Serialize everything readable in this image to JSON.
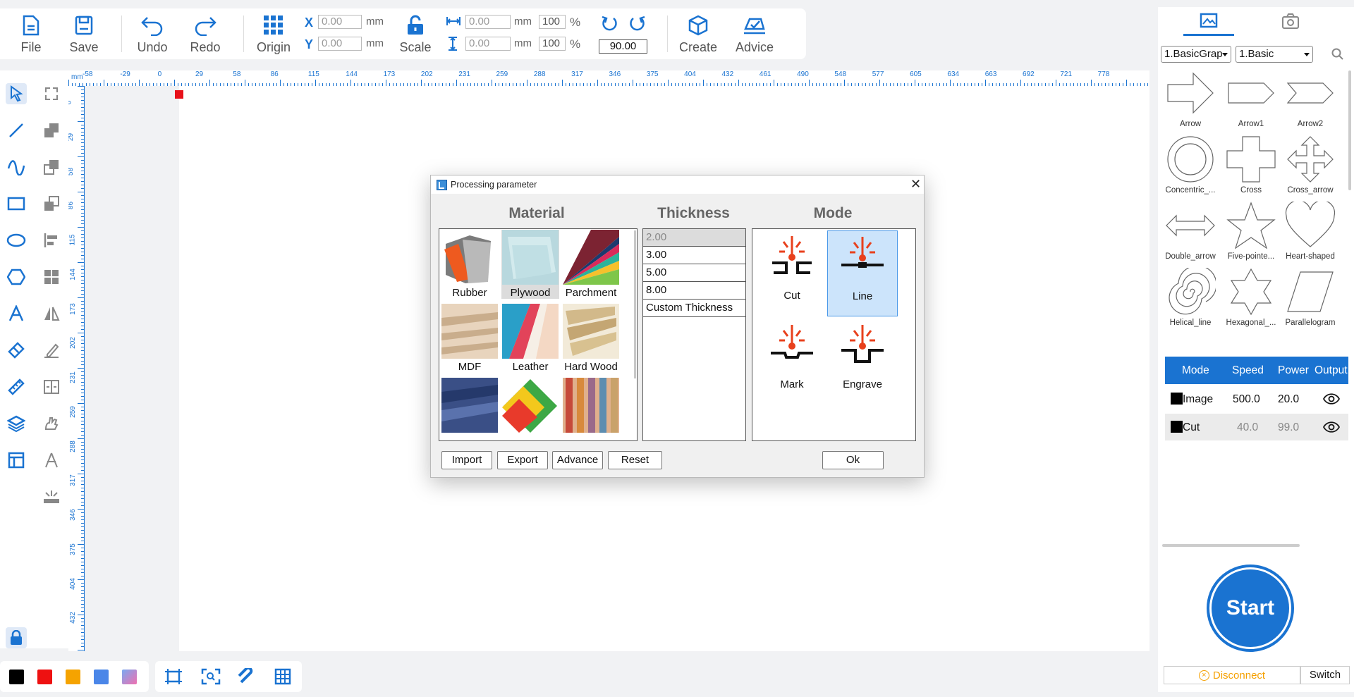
{
  "toolbar": {
    "file": "File",
    "save": "Save",
    "undo": "Undo",
    "redo": "Redo",
    "origin": "Origin",
    "scale": "Scale",
    "create": "Create",
    "advice": "Advice",
    "x_label": "X",
    "y_label": "Y",
    "x_value": "0.00",
    "y_value": "0.00",
    "unit": "mm",
    "w_value": "0.00",
    "h_value": "0.00",
    "w_pct": "100",
    "h_pct": "100",
    "pct_sign": "%",
    "rotation": "90.00"
  },
  "ruler": {
    "unit": "mm",
    "top_ticks": [
      "-58",
      "-29",
      "0",
      "29",
      "58",
      "86",
      "115",
      "144",
      "173",
      "202",
      "231",
      "259",
      "288",
      "317",
      "346",
      "375",
      "404",
      "432",
      "461",
      "490",
      "548",
      "577",
      "605",
      "634",
      "663",
      "692",
      "721",
      "778"
    ],
    "left_ticks": [
      "0",
      "29",
      "58",
      "86",
      "115",
      "144",
      "173",
      "202",
      "231",
      "259",
      "288",
      "317",
      "346",
      "375",
      "404",
      "432"
    ]
  },
  "colors": {
    "accent": "#1a73d1",
    "swatches": [
      "#000000",
      "#ee1111",
      "#f5a300",
      "#4a86e8",
      "#e870b0"
    ]
  },
  "dialog": {
    "title": "Processing parameter",
    "material_header": "Material",
    "thickness_header": "Thickness",
    "mode_header": "Mode",
    "materials": [
      "Rubber",
      "Plywood",
      "Parchment",
      "MDF",
      "Leather",
      "Hard Wood",
      "",
      "",
      ""
    ],
    "selected_material": "Plywood",
    "thickness": [
      "2.00",
      "3.00",
      "5.00",
      "8.00",
      "Custom Thickness"
    ],
    "selected_thickness": "2.00",
    "modes": [
      "Cut",
      "Line",
      "Mark",
      "Engrave"
    ],
    "selected_mode": "Line",
    "buttons": {
      "import": "Import",
      "export": "Export",
      "advance": "Advance",
      "reset": "Reset",
      "ok": "Ok"
    }
  },
  "right_panel": {
    "tabs": [
      "image-tab-icon",
      "camera-tab-icon"
    ],
    "library_select": "1.BasicGrap",
    "category_select": "1.Basic",
    "shapes": [
      "Arrow",
      "Arrow1",
      "Arrow2",
      "Concentric_...",
      "Cross",
      "Cross_arrow",
      "Double_arrow",
      "Five-pointe...",
      "Heart-shaped",
      "Helical_line",
      "Hexagonal_...",
      "Parallelogram"
    ]
  },
  "layers": {
    "headers": [
      "Mode",
      "Speed",
      "Power",
      "Output"
    ],
    "rows": [
      {
        "color": "#000000",
        "mode": "Image",
        "speed": "500.0",
        "power": "20.0"
      },
      {
        "color": "#000000",
        "mode": "Cut",
        "speed": "40.0",
        "power": "99.0"
      }
    ]
  },
  "start_label": "Start",
  "disconnect_label": "Disconnect",
  "switch_label": "Switch"
}
